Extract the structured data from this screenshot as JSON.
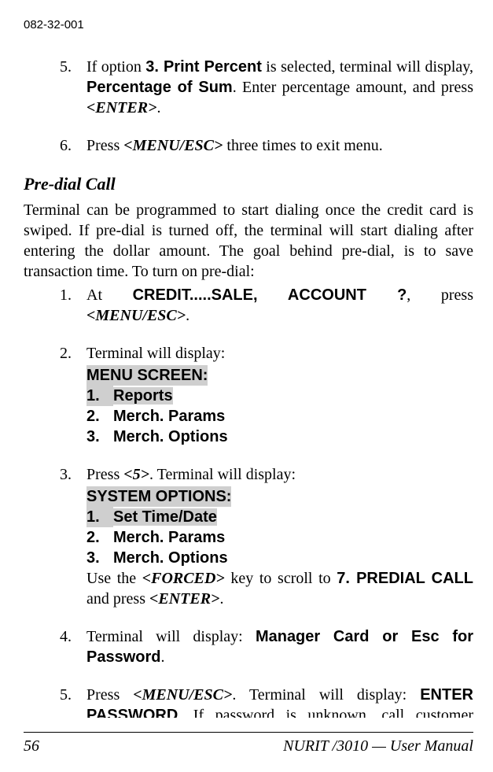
{
  "doc_id": "082-32-001",
  "section1": {
    "items": [
      {
        "num": "5.",
        "pre": "If option ",
        "opt_b": "3. Print Percent",
        "mid1": " is selected, terminal will display, ",
        "perc_b": "Percentage of Sum",
        "mid2": ".  Enter percentage amount, and press ",
        "key1": "<ENTER>",
        "tail": "."
      },
      {
        "num": "6.",
        "pre": "Press ",
        "key1": "<MENU/ESC>",
        "tail": " three times to exit menu."
      }
    ]
  },
  "sub_heading": "Pre-dial Call",
  "intro": "Terminal can be programmed to start dialing once the credit card is swiped. If pre-dial is turned off, the terminal will start dialing after entering the dollar amount.  The goal behind pre-dial, is to save transaction time. To turn on pre-dial:",
  "section2": {
    "items": [
      {
        "num": "1.",
        "pre": "At  ",
        "sans": "CREDIT.....SALE, ACCOUNT ?",
        "mid": ", press ",
        "key": "<MENU/ESC>",
        "tail": "."
      },
      {
        "num": "2.",
        "lead": "Terminal will display:",
        "menu_title": "MENU SCREEN:",
        "rows": [
          {
            "n": "1.",
            "label": "Reports",
            "hl": true
          },
          {
            "n": "2.",
            "label": "Merch. Params",
            "hl": false
          },
          {
            "n": "3.",
            "label": "Merch. Options",
            "hl": false
          }
        ]
      },
      {
        "num": "3.",
        "pre": "Press ",
        "key5": "<5>",
        "mid": ". Terminal will display:",
        "menu_title": "SYSTEM OPTIONS:",
        "rows": [
          {
            "n": "1.",
            "label": "Set Time/Date",
            "hl": true
          },
          {
            "n": "2.",
            "label": "Merch. Params",
            "hl": false
          },
          {
            "n": "3.",
            "label": "Merch. Options",
            "hl": false
          }
        ],
        "post_pre": "Use the ",
        "forced": "<FORCED>",
        "post_mid": " key to scroll to  ",
        "predial_b": "7. PREDIAL CALL",
        "post_and": "  and press ",
        "enter": "<ENTER>",
        "post_tail": "."
      },
      {
        "num": "4.",
        "pre": "Terminal will display: ",
        "sans": "Manager Card or Esc for Password",
        "tail": "."
      },
      {
        "num": "5.",
        "pre": "Press  ",
        "key": "<MENU/ESC>",
        "mid": ".  Terminal  will  display:  ",
        "enterpw": "ENTER PASSWORD",
        "tail": ".  If password is unknown, call customer service."
      }
    ]
  },
  "footer": {
    "page": "56",
    "right": "NURIT /3010 — User Manual"
  }
}
